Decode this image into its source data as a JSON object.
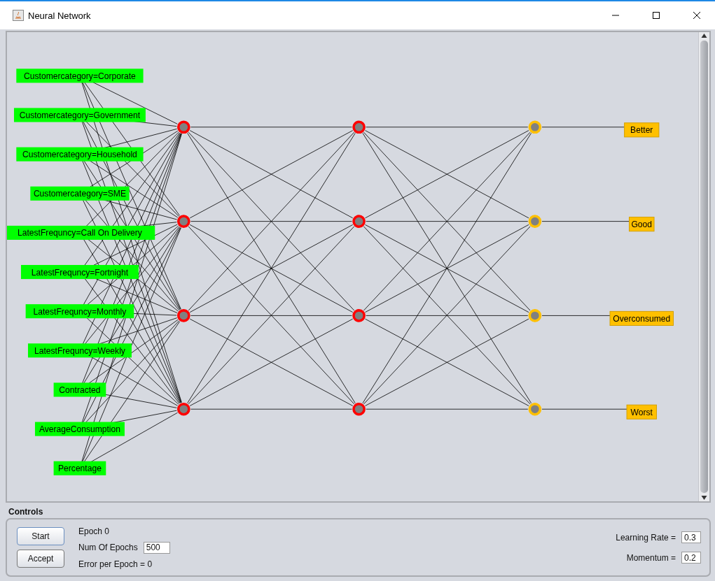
{
  "window": {
    "title": "Neural Network"
  },
  "network": {
    "inputs": [
      "Customercategory=Corporate",
      "Customercategory=Government",
      "Customercategory=Household",
      "Customercategory=SME",
      "LatestFrequncy=Call On Delivery",
      "LatestFrequncy=Fortnight",
      "LatestFrequncy=Monthly",
      "LatestFrequncy=Weekly",
      "Contracted",
      "AverageConsumption",
      "Percentage"
    ],
    "layers": [
      {
        "kind": "hidden",
        "color": "#ff0000"
      },
      {
        "kind": "hidden",
        "color": "#ff0000"
      },
      {
        "kind": "output",
        "color": "#ffc000"
      }
    ],
    "outputs": [
      "Better",
      "Good",
      "Overconsumed",
      "Worst"
    ]
  },
  "controls": {
    "title": "Controls",
    "buttons": [
      "Start",
      "Accept"
    ],
    "epoch": "Epoch  0",
    "num_epochs": {
      "label": "Num Of Epochs",
      "value": "500"
    },
    "error": "Error per Epoch = 0",
    "learning_rate": {
      "label": "Learning Rate =",
      "value": "0.3"
    },
    "momentum": {
      "label": "Momentum =",
      "value": "0.2"
    }
  }
}
